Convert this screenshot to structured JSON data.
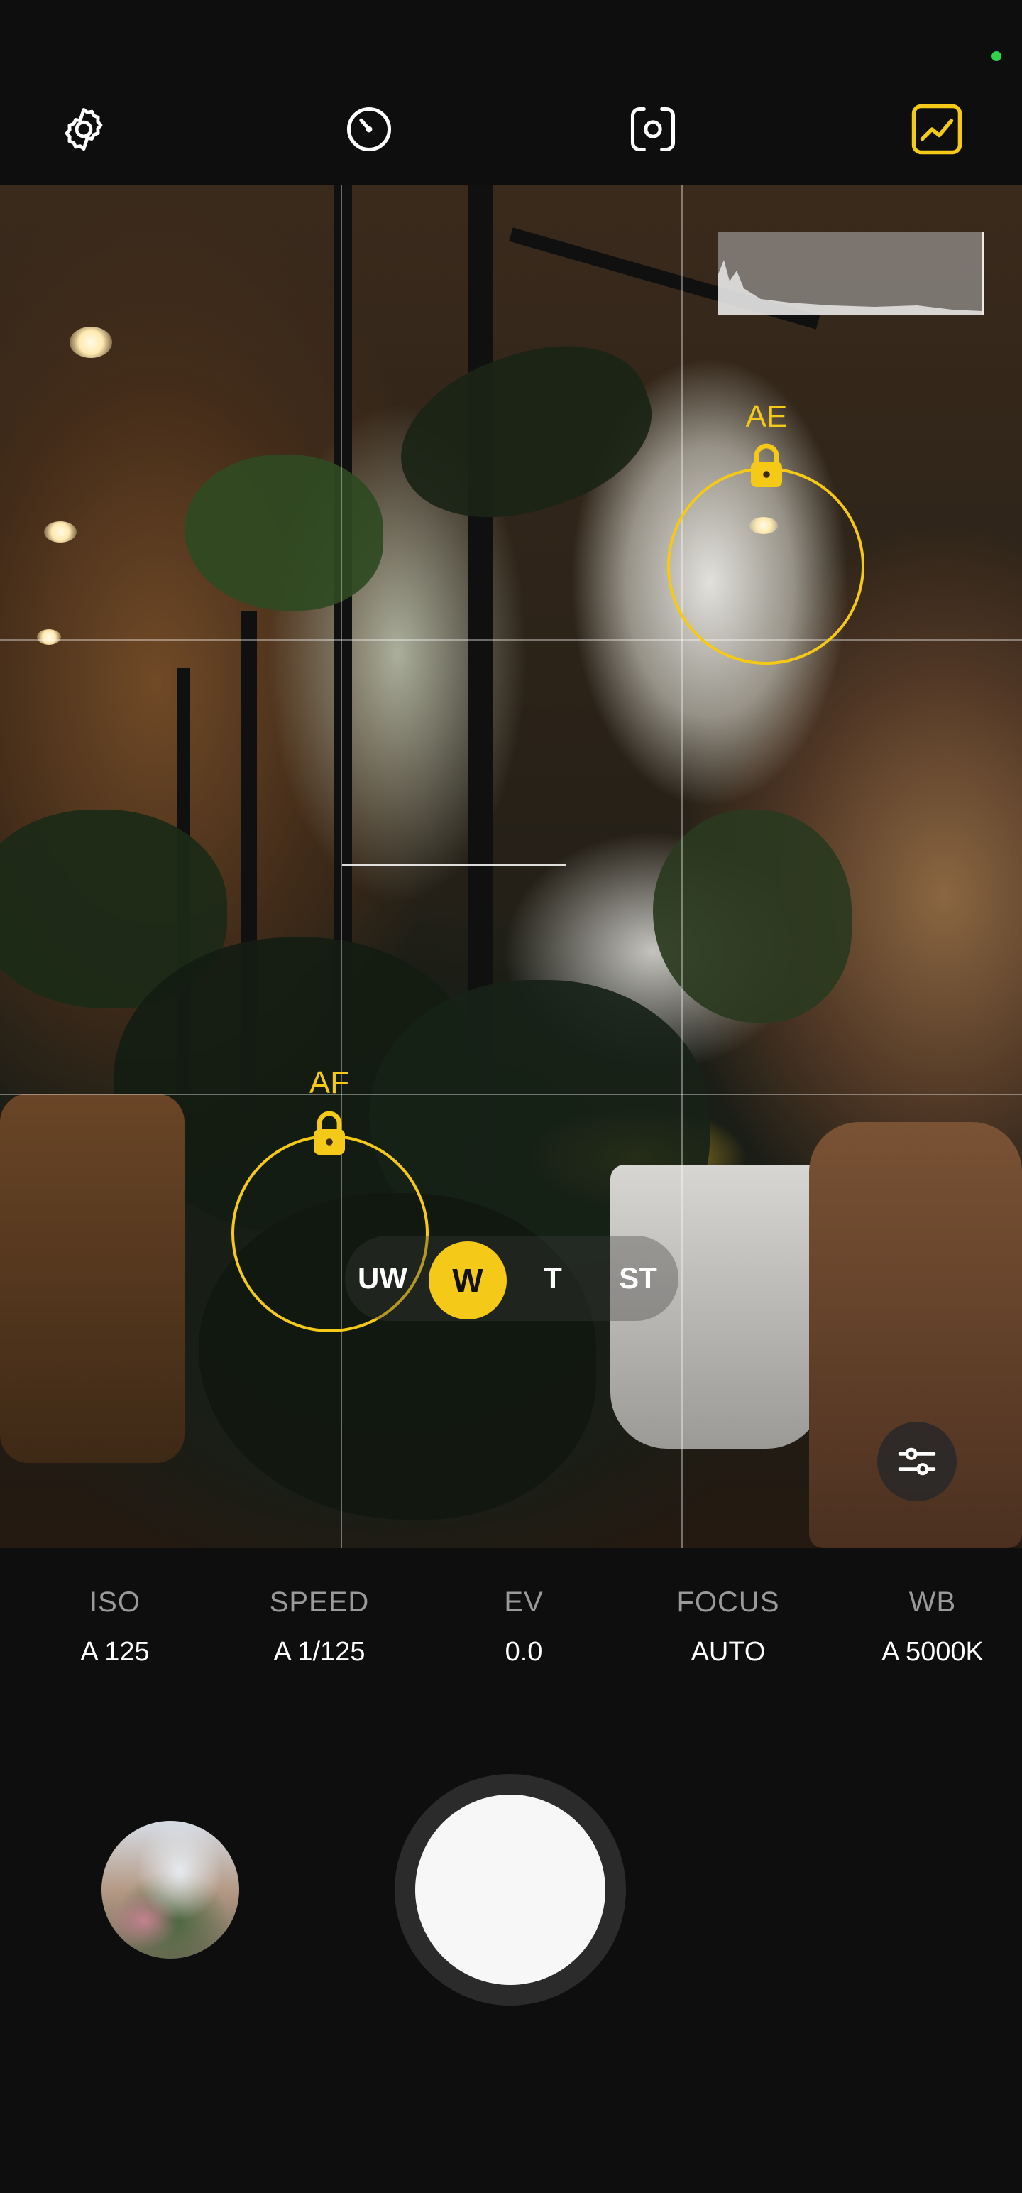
{
  "toolbar": {
    "settings_icon": "gear-icon",
    "timer_icon": "timer-icon",
    "camera_switch_icon": "camera-flip-icon",
    "histogram_toggle_icon": "histogram-icon",
    "accent_color": "#f5c918"
  },
  "locks": {
    "ae_label": "AE",
    "af_label": "AF",
    "lock_icon": "lock-icon"
  },
  "zoom": {
    "options": [
      "UW",
      "W",
      "T",
      "ST"
    ],
    "selected": "W"
  },
  "params": [
    {
      "name": "ISO",
      "value": "A 125"
    },
    {
      "name": "SPEED",
      "value": "A 1/125"
    },
    {
      "name": "EV",
      "value": "0.0"
    },
    {
      "name": "FOCUS",
      "value": "AUTO"
    },
    {
      "name": "WB",
      "value": "A 5000K"
    }
  ],
  "controls": {
    "adjust_icon": "sliders-icon",
    "shutter_icon": "shutter-button",
    "gallery_icon": "gallery-thumbnail"
  }
}
